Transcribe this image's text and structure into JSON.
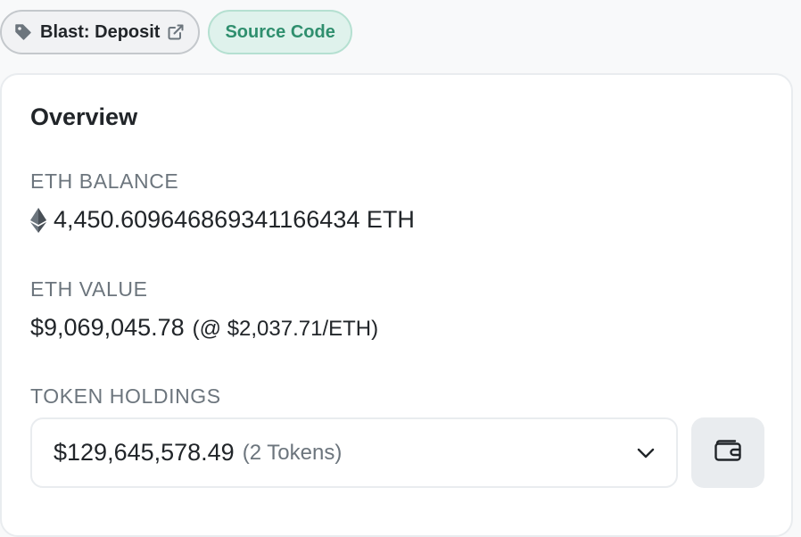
{
  "tags": {
    "label_text": "Blast: Deposit",
    "source_text": "Source Code"
  },
  "overview": {
    "title": "Overview",
    "eth_balance_label": "ETH BALANCE",
    "eth_balance_value": "4,450.609646869341166434 ETH",
    "eth_value_label": "ETH VALUE",
    "eth_value_amount": "$9,069,045.78",
    "eth_value_rate": "(@ $2,037.71/ETH)",
    "token_holdings_label": "TOKEN HOLDINGS",
    "token_holdings_amount": "$129,645,578.49",
    "token_holdings_count": "(2 Tokens)"
  },
  "icons": {
    "tag": "tag-icon",
    "external_link": "external-link-icon",
    "ethereum": "ethereum-icon",
    "chevron": "chevron-down-icon",
    "wallet": "wallet-icon"
  },
  "colors": {
    "source_code_text": "#2f8f6e",
    "source_code_bg": "#dff2ec",
    "muted_text": "#6c757d"
  }
}
